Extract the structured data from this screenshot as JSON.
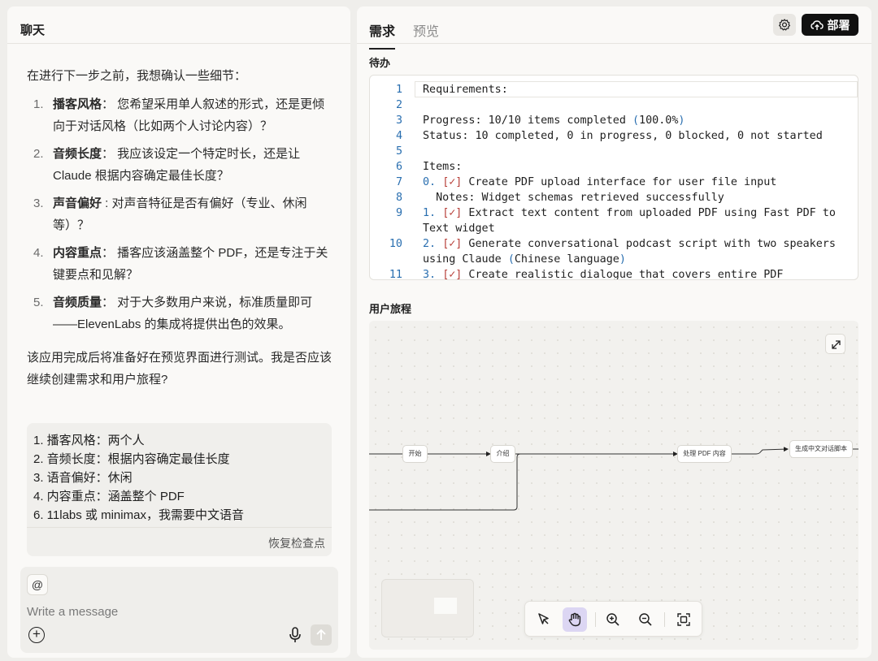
{
  "chat": {
    "title": "聊天",
    "intro": "在进行下一步之前，我想确认一些细节：",
    "questions": [
      {
        "num": "1.",
        "key": "播客风格",
        "text": "： 您希望采用单人叙述的形式，还是更倾向于对话风格（比如两个人讨论内容）？"
      },
      {
        "num": "2.",
        "key": "音频长度",
        "text": "： 我应该设定一个特定时长，还是让 Claude 根据内容确定最佳长度？"
      },
      {
        "num": "3.",
        "key": "声音偏好",
        "text": " : 对声音特征是否有偏好（专业、休闲等）？"
      },
      {
        "num": "4.",
        "key": "内容重点",
        "text": "： 播客应该涵盖整个 PDF，还是专注于关键要点和见解？"
      },
      {
        "num": "5.",
        "key": "音频质量",
        "text": "： 对于大多数用户来说，标准质量即可——ElevenLabs 的集成将提供出色的效果。"
      }
    ],
    "outro": "该应用完成后将准备好在预览界面进行测试。我是否应该继续创建需求和用户旅程?",
    "user_message_lines": [
      "1. 播客风格：两个人",
      "2. 音频长度：根据内容确定最佳长度",
      "3. 语音偏好：休闲",
      "4. 内容重点：涵盖整个 PDF",
      "6. 11labs 或 minimax，我需要中文语音"
    ],
    "restore_label": "恢复检查点",
    "composer": {
      "mention_label": "@",
      "placeholder": "Write a message",
      "plus_label": "+"
    }
  },
  "right": {
    "tabs": [
      {
        "label": "需求",
        "active": true
      },
      {
        "label": "预览",
        "active": false
      }
    ],
    "deploy_label": "部署",
    "todo_label": "待办",
    "journey_label": "用户旅程",
    "code_lines": [
      {
        "n": "1",
        "segs": [
          {
            "t": "Requirements:"
          }
        ]
      },
      {
        "n": "2",
        "segs": [
          {
            "t": ""
          }
        ]
      },
      {
        "n": "3",
        "segs": [
          {
            "t": "Progress: 10/10 items completed "
          },
          {
            "t": "(",
            "c": "blue"
          },
          {
            "t": "100.0%"
          },
          {
            "t": ")",
            "c": "blue"
          }
        ]
      },
      {
        "n": "4",
        "segs": [
          {
            "t": "Status: 10 completed, 0 in progress, 0 blocked, 0 not started"
          }
        ]
      },
      {
        "n": "5",
        "segs": [
          {
            "t": ""
          }
        ]
      },
      {
        "n": "6",
        "segs": [
          {
            "t": "Items:"
          }
        ]
      },
      {
        "n": "7",
        "segs": [
          {
            "t": "0.",
            "c": "blue"
          },
          {
            "t": " "
          },
          {
            "t": "[✓]",
            "c": "red"
          },
          {
            "t": " Create PDF upload interface for user file input"
          }
        ]
      },
      {
        "n": "8",
        "segs": [
          {
            "t": "  Notes: Widget schemas retrieved successfully"
          }
        ]
      },
      {
        "n": "9",
        "segs": [
          {
            "t": "1.",
            "c": "blue"
          },
          {
            "t": " "
          },
          {
            "t": "[✓]",
            "c": "red"
          },
          {
            "t": " Extract text content from uploaded PDF using Fast PDF to Text widget"
          }
        ]
      },
      {
        "n": "10",
        "segs": [
          {
            "t": "2.",
            "c": "blue"
          },
          {
            "t": " "
          },
          {
            "t": "[✓]",
            "c": "red"
          },
          {
            "t": " Generate conversational podcast script with two speakers using Claude "
          },
          {
            "t": "(",
            "c": "blue"
          },
          {
            "t": "Chinese language"
          },
          {
            "t": ")",
            "c": "blue"
          }
        ]
      },
      {
        "n": "11",
        "segs": [
          {
            "t": "3.",
            "c": "blue"
          },
          {
            "t": " "
          },
          {
            "t": "[✓]",
            "c": "red"
          },
          {
            "t": " Create realistic dialogue that covers entire PDF"
          }
        ]
      }
    ],
    "flow_nodes": [
      "开始",
      "介绍",
      "处理 PDF 内容",
      "生成中文对话脚本"
    ],
    "toolbar_tools": [
      "pointer-tool",
      "hand-tool",
      "zoom-in-tool",
      "zoom-out-tool",
      "fit-view-tool"
    ],
    "colors": {
      "accent_dark": "#111111",
      "code_blue": "#2a6fb0",
      "code_red": "#b8403a",
      "active_tool_bg": "#dcd6f3"
    }
  }
}
